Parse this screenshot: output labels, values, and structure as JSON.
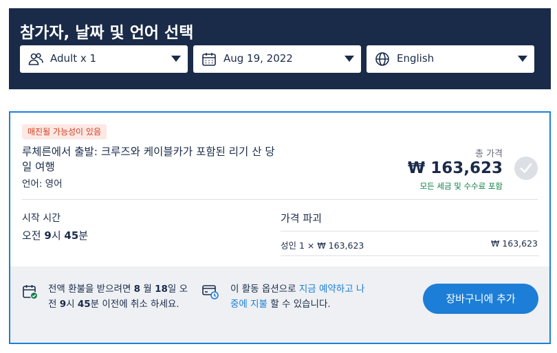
{
  "header": {
    "title": "참가자, 날짜 및 언어 선택",
    "participants": "Adult x 1",
    "date": "Aug 19, 2022",
    "language": "English",
    "bg_color": "#1a2b49"
  },
  "option": {
    "badge": "매진될 가능성이 있음",
    "title": "루체른에서 출발: 크루즈와 케이블카가 포함된 리기 산 당일 여행",
    "language": "언어: 영어",
    "total_label": "총 가격",
    "total_price": "₩ 163,623",
    "price_note": "모든 세금 및 수수료 포함",
    "start_time_label": "시작 시간",
    "start_time_value_parts": [
      "오전 ",
      "9",
      "시 ",
      "45",
      "분"
    ],
    "breakdown_title": "가격 파괴",
    "breakdown_row_label": "성인 1 × ₩ 163,623",
    "breakdown_row_value": "₩ 163,623"
  },
  "footer": {
    "refund_parts": [
      "전액 환불을 받으려면 ",
      "8",
      " 월 ",
      "18",
      "일 오전 ",
      "9",
      "시 ",
      "45",
      "분 이전에 취소 하세요."
    ],
    "reserve_prefix": "이 활동 옵션으로 ",
    "reserve_link": "지금 예약하고 나중에 지불",
    "reserve_suffix": " 할 수 있습니다.",
    "add_to_cart": "장바구니에 추가"
  },
  "colors": {
    "accent": "#1c7ed6",
    "badge_text": "#d43b1e",
    "badge_bg": "#fde8e4",
    "success": "#0a7d46"
  },
  "icons": [
    "participants-icon",
    "calendar-icon",
    "globe-icon",
    "chevron-down-icon",
    "checkmark-icon",
    "calendar-check-icon",
    "card-clock-icon"
  ]
}
